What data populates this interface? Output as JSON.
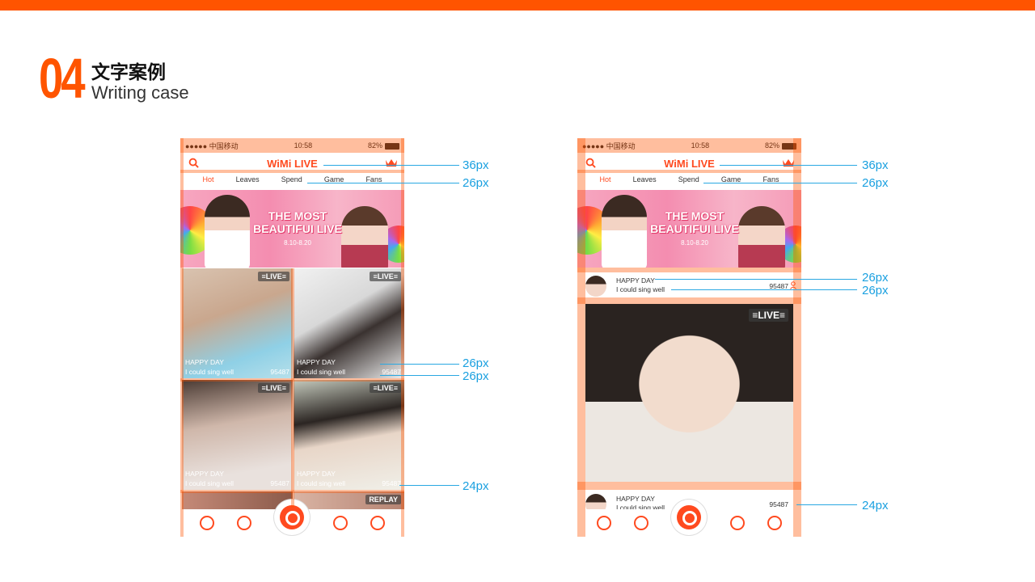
{
  "header": {
    "number": "04",
    "title_cn": "文字案例",
    "title_en": "Writing case"
  },
  "phone": {
    "carrier": "●●●●● 中国移动",
    "time": "10:58",
    "battery": "82%",
    "app_title": "WiMi LIVE",
    "tabs": [
      "Hot",
      "Leaves",
      "Spend",
      "Game",
      "Fans"
    ],
    "banner": {
      "line1": "THE MOST",
      "line2": "BEAUTIFUI LIVE",
      "date": "8.10-8.20"
    },
    "live_badge": "≡LIVE≡",
    "replay_badge": "REPLAY",
    "card_title": "HAPPY DAY",
    "card_sub": "I could sing well",
    "card_count": "95487"
  },
  "dims": {
    "d36": "36px",
    "d26": "26px",
    "d24": "24px"
  },
  "colors": {
    "brand": "#ff5400",
    "accent": "#ff4a1f",
    "dim": "#1aa0e0"
  }
}
